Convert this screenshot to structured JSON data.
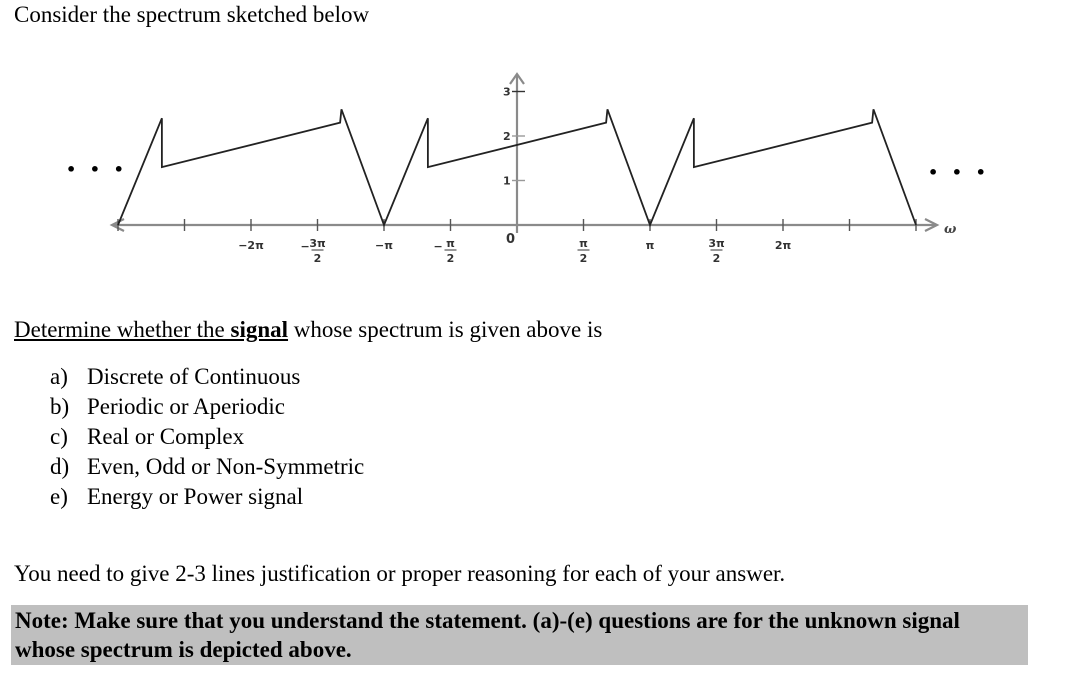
{
  "intro": "Consider the spectrum sketched below",
  "diagram": {
    "axis_label": "ω",
    "ellipsis": "• • •",
    "x_ticks": [
      {
        "value_pi": -2.0,
        "label": "−2π"
      },
      {
        "value_pi": -1.5,
        "label": "− 3π/2"
      },
      {
        "value_pi": -1.0,
        "label": "−π"
      },
      {
        "value_pi": -0.5,
        "label": "−π/2"
      },
      {
        "value_pi": 0,
        "label": "0"
      },
      {
        "value_pi": 0.5,
        "label": "π/2"
      },
      {
        "value_pi": 1.0,
        "label": "π"
      },
      {
        "value_pi": 1.5,
        "label": "3π/2"
      },
      {
        "value_pi": 2.0,
        "label": "2π"
      }
    ],
    "unlabeled_ticks_pi": [
      -3.0,
      -2.5,
      2.5,
      3.0
    ],
    "y_ticks": [
      {
        "value": 1,
        "label": "1"
      },
      {
        "value": 2,
        "label": "2"
      },
      {
        "value": 3,
        "label": "3"
      }
    ],
    "period_pi": 2,
    "one_period_vertices": [
      {
        "w_pi": -1.0,
        "amp": 0
      },
      {
        "w_pi": -0.67,
        "amp": 2.4
      },
      {
        "w_pi": -0.67,
        "amp": 1.3
      },
      {
        "w_pi": 0.67,
        "amp": 2.3
      },
      {
        "w_pi": 0.68,
        "amp": 2.6
      },
      {
        "w_pi": 1.0,
        "amp": 0
      }
    ],
    "periods_shown_centers_pi": [
      -2,
      0,
      2
    ]
  },
  "question": {
    "underlined_prefix": "Determine whether the ",
    "bold_word": "signal",
    "suffix": " whose spectrum is given above is"
  },
  "options": [
    {
      "letter": "a)",
      "text": "Discrete of Continuous"
    },
    {
      "letter": "b)",
      "text": "Periodic or Aperiodic"
    },
    {
      "letter": "c)",
      "text": "Real or Complex"
    },
    {
      "letter": "d)",
      "text": "Even, Odd or Non-Symmetric"
    },
    {
      "letter": "e)",
      "text": "Energy or Power signal"
    }
  ],
  "instructions": "You need to give 2-3 lines justification or proper reasoning for each of your answer.",
  "note": {
    "line1": "Note: Make sure that you understand the statement. (a)-(e) questions are for the unknown signal",
    "line2": "whose spectrum is depicted above."
  }
}
